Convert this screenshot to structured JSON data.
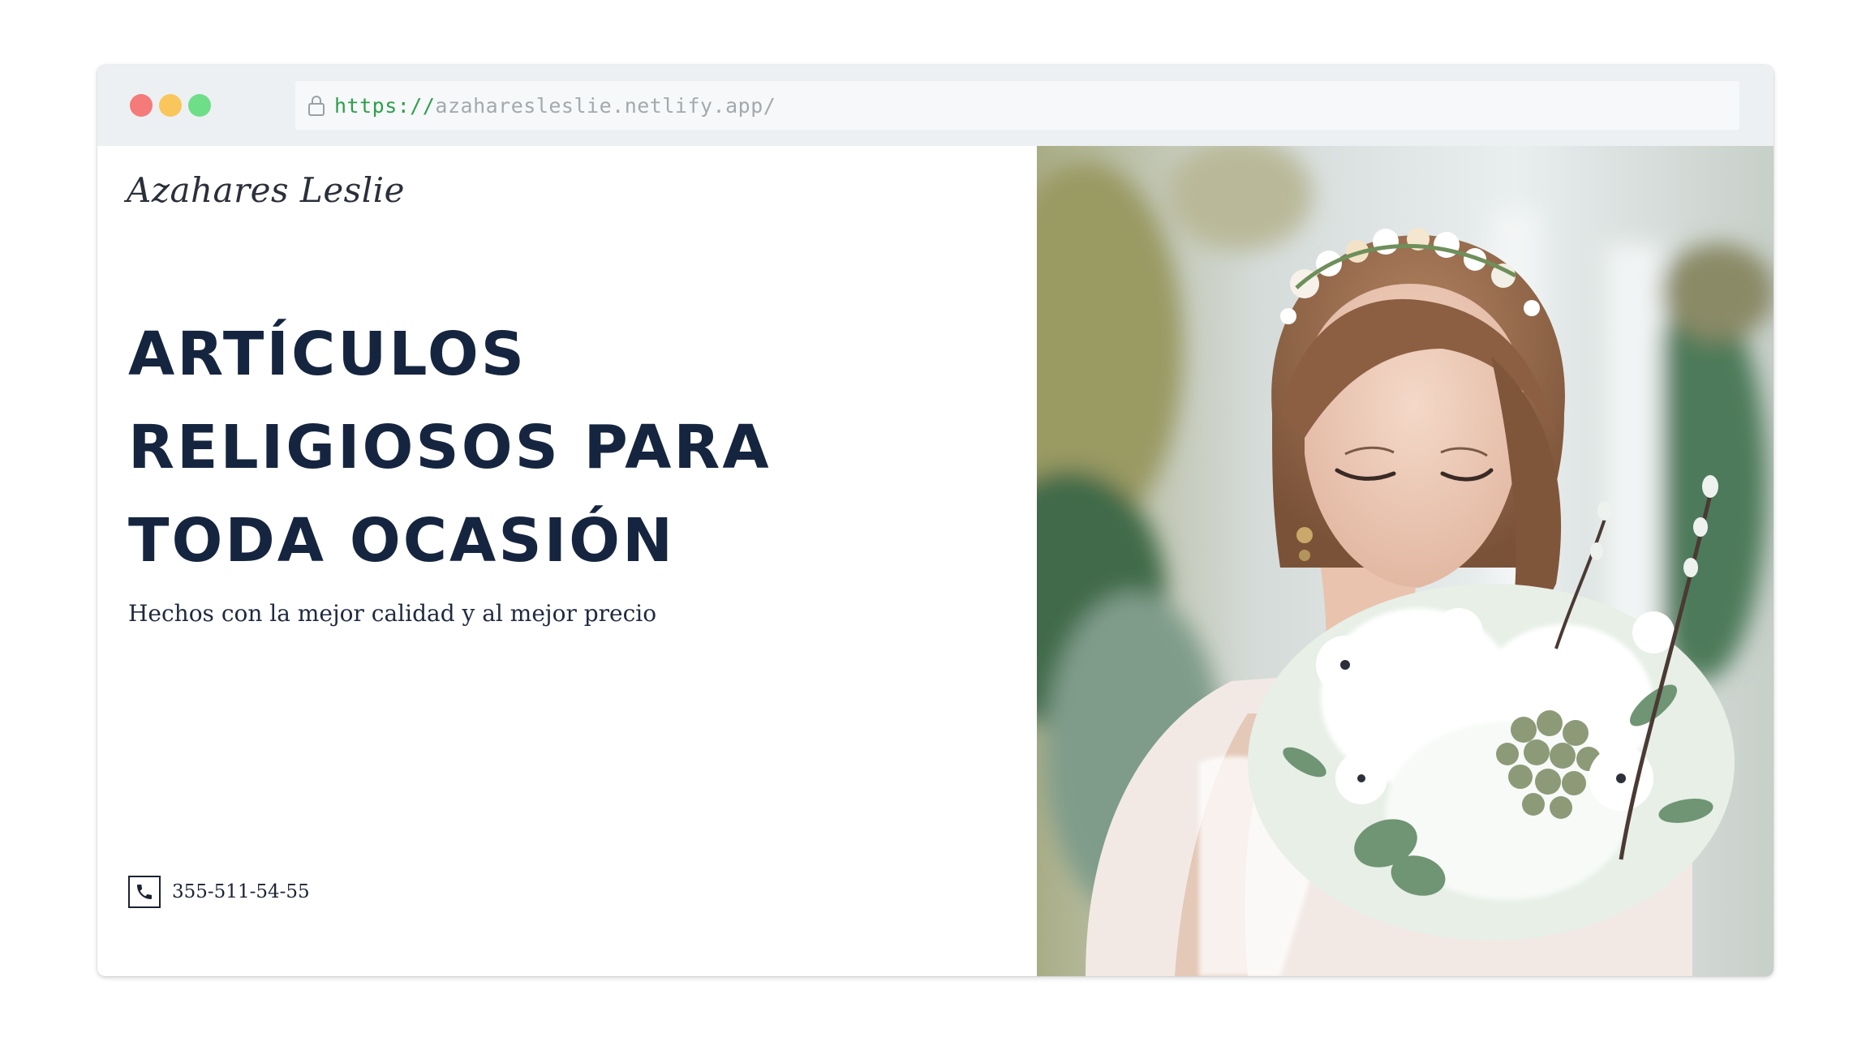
{
  "browser": {
    "url_scheme": "https://",
    "url_host": "azaharesleslie.netlify.app/",
    "window_controls": {
      "close_color": "#f57a7a",
      "minimize_color": "#f8c65a",
      "maximize_color": "#6ede88"
    }
  },
  "site": {
    "logo": "Azahares Leslie",
    "headline_lines": [
      "ARTÍCULOS",
      "RELIGIOSOS PARA",
      "TODA OCASIÓN"
    ],
    "subtitle": "Hechos con la mejor calidad y al mejor precio",
    "phone": "355-511-54-55",
    "phone_icon": "phone-icon"
  },
  "hero": {
    "image": "bride-holding-white-bouquet"
  },
  "colors": {
    "headline": "#16253f",
    "toolbar": "#ecf0f2",
    "url_scheme": "#2e9e4b",
    "url_host": "#a3a9ad"
  }
}
